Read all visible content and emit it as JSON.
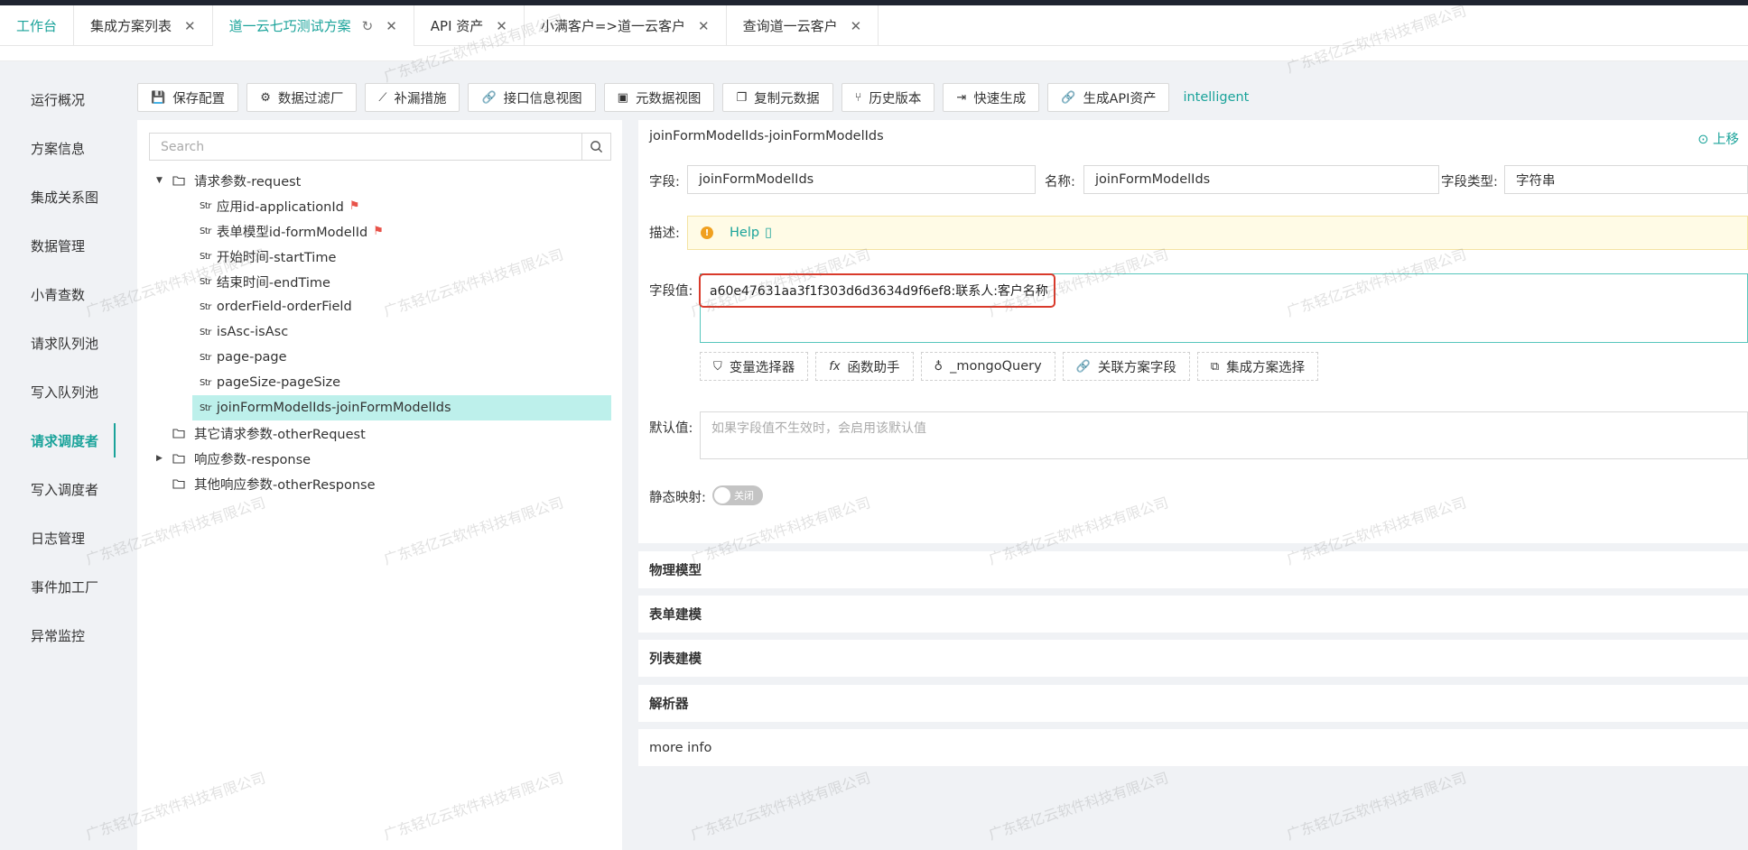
{
  "tabs": [
    {
      "label": "工作台",
      "active": false,
      "closable": false,
      "refresh": false
    },
    {
      "label": "集成方案列表",
      "active": false,
      "closable": true,
      "refresh": false
    },
    {
      "label": "道一云七巧测试方案",
      "active": true,
      "closable": true,
      "refresh": true
    },
    {
      "label": "API 资产",
      "active": false,
      "closable": true,
      "refresh": false
    },
    {
      "label": "小满客户=>道一云客户",
      "active": false,
      "closable": true,
      "refresh": false
    },
    {
      "label": "查询道一云客户",
      "active": false,
      "closable": true,
      "refresh": false
    }
  ],
  "sidebar": {
    "items": [
      {
        "label": "运行概况"
      },
      {
        "label": "方案信息"
      },
      {
        "label": "集成关系图"
      },
      {
        "label": "数据管理"
      },
      {
        "label": "小青查数"
      },
      {
        "label": "请求队列池"
      },
      {
        "label": "写入队列池"
      },
      {
        "label": "请求调度者",
        "active": true
      },
      {
        "label": "写入调度者"
      },
      {
        "label": "日志管理"
      },
      {
        "label": "事件加工厂"
      },
      {
        "label": "异常监控"
      }
    ]
  },
  "toolbar": {
    "buttons": [
      {
        "label": "保存配置",
        "icon": "save-icon"
      },
      {
        "label": "数据过滤厂",
        "icon": "gear-icon"
      },
      {
        "label": "补漏措施",
        "icon": "trend-icon"
      },
      {
        "label": "接口信息视图",
        "icon": "link-icon"
      },
      {
        "label": "元数据视图",
        "icon": "terminal-icon"
      },
      {
        "label": "复制元数据",
        "icon": "copy-icon"
      },
      {
        "label": "历史版本",
        "icon": "branch-icon"
      },
      {
        "label": "快速生成",
        "icon": "export-icon"
      },
      {
        "label": "生成API资产",
        "icon": "link-icon"
      }
    ],
    "link_label": "intelligent"
  },
  "tree": {
    "search_placeholder": "Search",
    "nodes": [
      {
        "label": "请求参数-request",
        "type": "folder",
        "expanded": true
      },
      {
        "label": "应用id-applicationId",
        "type": "str",
        "flag": true
      },
      {
        "label": "表单模型id-formModelId",
        "type": "str",
        "flag": true
      },
      {
        "label": "开始时间-startTime",
        "type": "str"
      },
      {
        "label": "结束时间-endTime",
        "type": "str"
      },
      {
        "label": "orderField-orderField",
        "type": "str"
      },
      {
        "label": "isAsc-isAsc",
        "type": "str"
      },
      {
        "label": "page-page",
        "type": "str"
      },
      {
        "label": "pageSize-pageSize",
        "type": "str"
      },
      {
        "label": "joinFormModelIds-joinFormModelIds",
        "type": "str",
        "selected": true
      },
      {
        "label": "其它请求参数-otherRequest",
        "type": "folder"
      },
      {
        "label": "响应参数-response",
        "type": "folder",
        "collapsed": true
      },
      {
        "label": "其他响应参数-otherResponse",
        "type": "folder"
      }
    ],
    "str_tag": "Str"
  },
  "detail": {
    "title": "joinFormModelIds-joinFormModelIds",
    "move_up_label": "上移",
    "field_label": "字段:",
    "field_value": "joinFormModelIds",
    "name_label": "名称:",
    "name_value": "joinFormModelIds",
    "type_label": "字段类型:",
    "type_value": "字符串",
    "desc_label": "描述:",
    "help_label": "Help",
    "value_label": "字段值:",
    "value_text": "a60e47631aa3f1f303d6d3634d9f6ef8:联系人:客户名称",
    "helpers": [
      {
        "label": "变量选择器",
        "icon": "filter-icon"
      },
      {
        "label": "函数助手",
        "icon": "fx-icon"
      },
      {
        "label": "_mongoQuery",
        "icon": "bulb-icon"
      },
      {
        "label": "关联方案字段",
        "icon": "link-icon"
      },
      {
        "label": "集成方案选择",
        "icon": "cluster-icon"
      }
    ],
    "default_label": "默认值:",
    "default_placeholder": "如果字段值不生效时，会启用该默认值",
    "static_label": "静态映射:",
    "toggle_text": "关闭"
  },
  "sections": [
    {
      "label": "物理模型"
    },
    {
      "label": "表单建模"
    },
    {
      "label": "列表建模"
    },
    {
      "label": "解析器"
    },
    {
      "label": "more info"
    }
  ],
  "watermark_text": "广东轻亿云软件科技有限公司",
  "colors": {
    "accent": "#1aa39a",
    "highlight_border": "#d93a2b",
    "selected_row": "#bdf0eb"
  }
}
